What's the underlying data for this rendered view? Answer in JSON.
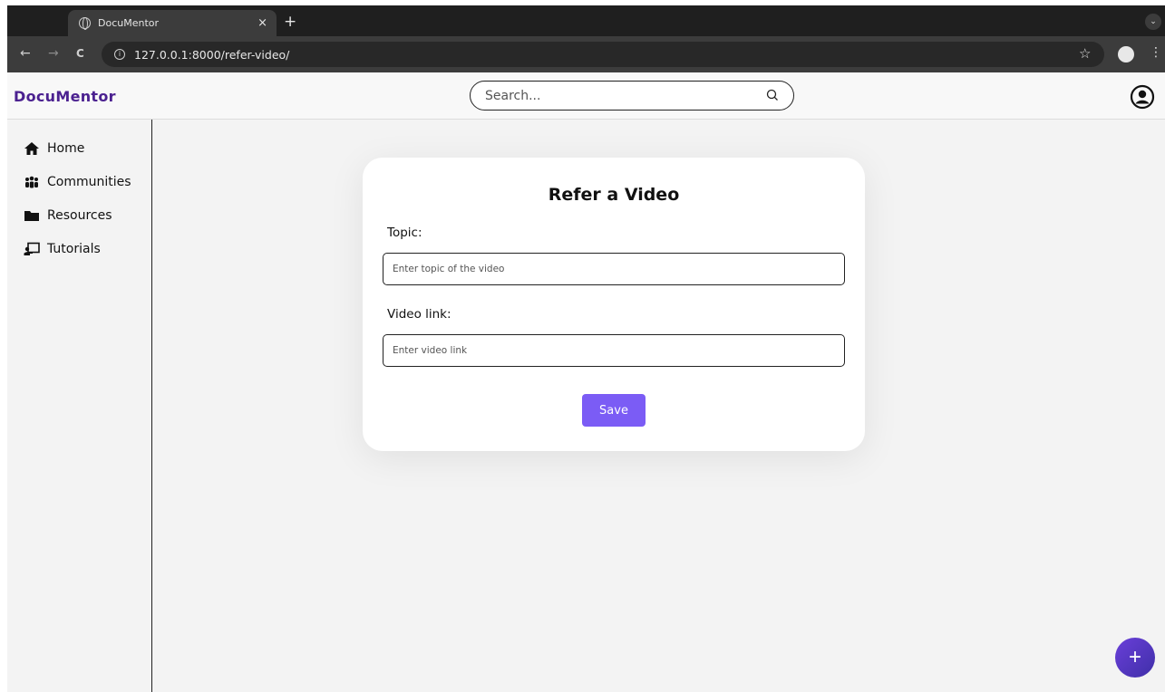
{
  "browser": {
    "tab_title": "DocuMentor",
    "tab_close": "×",
    "new_tab": "+",
    "tab_menu": "⌄",
    "url": "127.0.0.1:8000/refer-video/",
    "back": "←",
    "forward": "→",
    "reload": "C",
    "bookmark": "☆",
    "menu": "⋮"
  },
  "header": {
    "brand": "DocuMentor",
    "search_placeholder": "Search..."
  },
  "sidebar": {
    "items": [
      {
        "label": "Home",
        "icon": "home-icon"
      },
      {
        "label": "Communities",
        "icon": "users-icon"
      },
      {
        "label": "Resources",
        "icon": "folder-icon"
      },
      {
        "label": "Tutorials",
        "icon": "chalkboard-teacher-icon"
      }
    ]
  },
  "form": {
    "title": "Refer a Video",
    "topic_label": "Topic:",
    "topic_placeholder": "Enter topic of the video",
    "link_label": "Video link:",
    "link_placeholder": "Enter video link",
    "save_label": "Save"
  },
  "fab": {
    "label": "+"
  },
  "colors": {
    "brand": "#4b2190",
    "accent": "#7b5cf5",
    "fab": "#5a36c8"
  }
}
